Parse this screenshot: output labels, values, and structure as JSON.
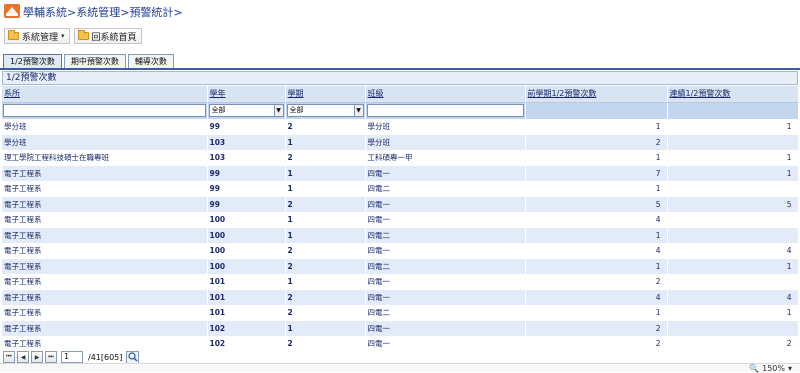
{
  "breadcrumb": [
    "學輔系統",
    ">",
    "系統管理",
    ">",
    "預警統計",
    ">"
  ],
  "toolbar": {
    "manage_label": "系統管理",
    "home_label": "回系統首頁"
  },
  "tabs": [
    {
      "label": "1/2預警次數",
      "active": true
    },
    {
      "label": "期中預警次數",
      "active": false
    },
    {
      "label": "輔導次數",
      "active": false
    }
  ],
  "panel": {
    "title": "1/2預警次數"
  },
  "columns": [
    "系所",
    "學年",
    "學期",
    "班級",
    "前學期1/2預警次數",
    "連續1/2預警次數"
  ],
  "filters": {
    "year": "全部",
    "term": "全部"
  },
  "rows": [
    [
      "學分班",
      "99",
      "2",
      "學分班",
      "1",
      "1"
    ],
    [
      "學分班",
      "103",
      "1",
      "學分班",
      "2",
      ""
    ],
    [
      "理工學院工程科技碩士在職專班",
      "103",
      "2",
      "工科碩專一甲",
      "1",
      "1"
    ],
    [
      "電子工程系",
      "99",
      "1",
      "四電一",
      "7",
      "1"
    ],
    [
      "電子工程系",
      "99",
      "1",
      "四電二",
      "1",
      ""
    ],
    [
      "電子工程系",
      "99",
      "2",
      "四電一",
      "5",
      "5"
    ],
    [
      "電子工程系",
      "100",
      "1",
      "四電一",
      "4",
      ""
    ],
    [
      "電子工程系",
      "100",
      "1",
      "四電二",
      "1",
      ""
    ],
    [
      "電子工程系",
      "100",
      "2",
      "四電一",
      "4",
      "4"
    ],
    [
      "電子工程系",
      "100",
      "2",
      "四電二",
      "1",
      "1"
    ],
    [
      "電子工程系",
      "101",
      "1",
      "四電一",
      "2",
      ""
    ],
    [
      "電子工程系",
      "101",
      "2",
      "四電一",
      "4",
      "4"
    ],
    [
      "電子工程系",
      "101",
      "2",
      "四電二",
      "1",
      "1"
    ],
    [
      "電子工程系",
      "102",
      "1",
      "四電一",
      "2",
      ""
    ],
    [
      "電子工程系",
      "102",
      "2",
      "四電一",
      "2",
      "2"
    ]
  ],
  "pager": {
    "page": "1",
    "total": "/41[605]"
  },
  "status": {
    "zoom": "150%"
  }
}
